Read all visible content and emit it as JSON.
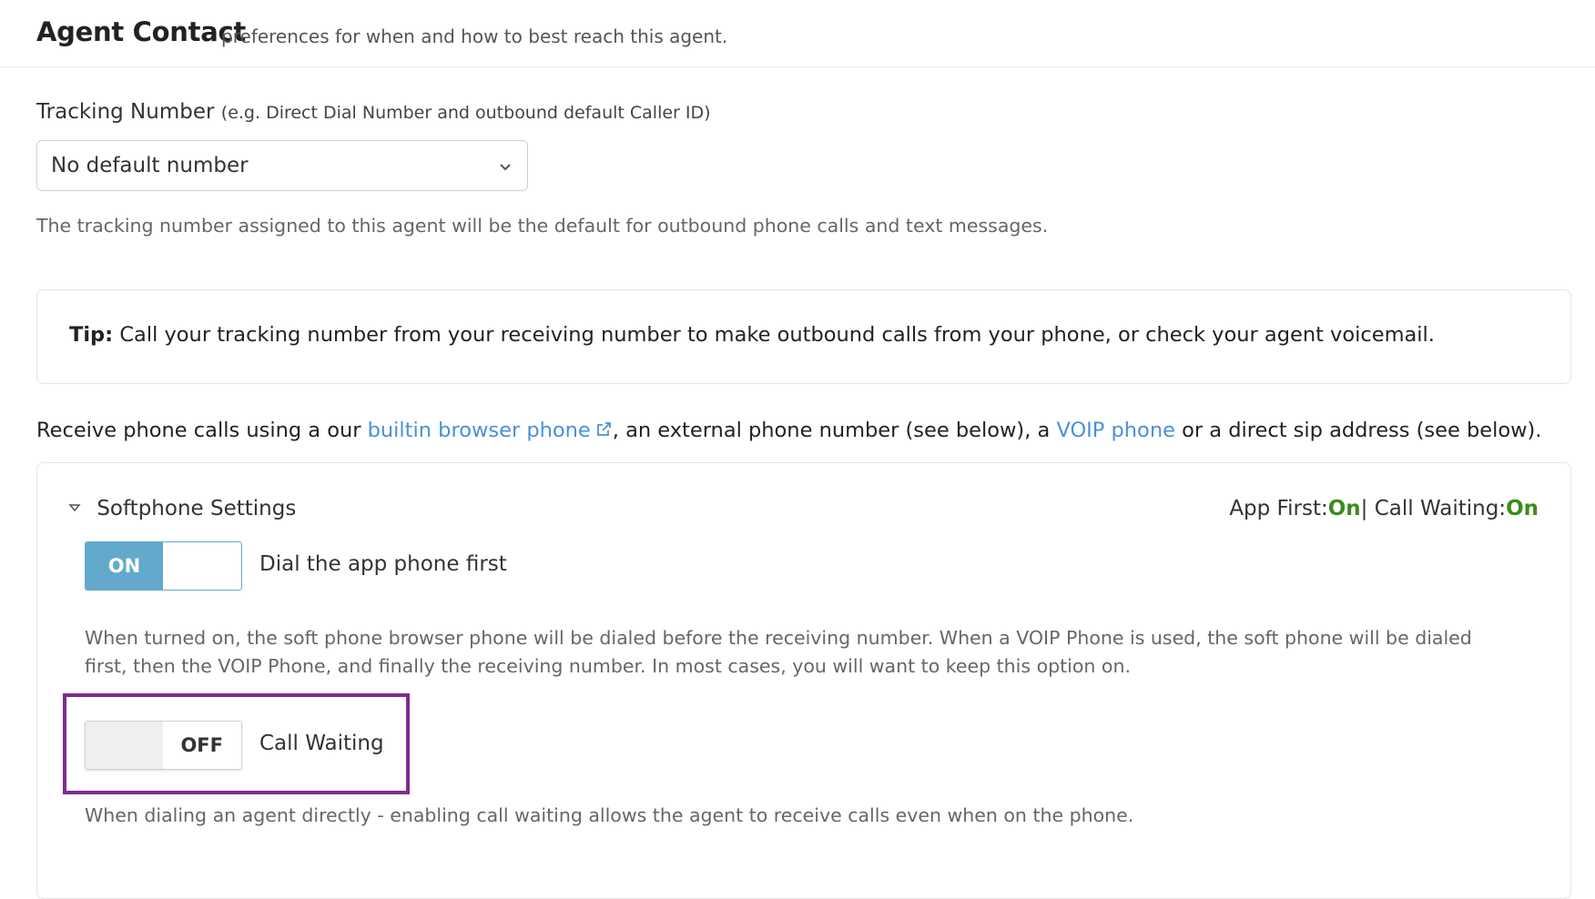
{
  "header": {
    "title": "Agent Contact",
    "subtitle": "preferences for when and how to best reach this agent."
  },
  "tracking": {
    "label": "Tracking Number",
    "label_hint": "(e.g. Direct Dial Number and outbound default Caller ID)",
    "selected_value": "No default number",
    "help_text": "The tracking number assigned to this agent will be the default for outbound phone calls and text messages."
  },
  "tip": {
    "prefix": "Tip:",
    "text": "Call your tracking number from your receiving number to make outbound calls from your phone, or check your agent voicemail."
  },
  "receive": {
    "text_1": "Receive phone calls using a our ",
    "link_1": "builtin browser phone",
    "text_2": ", an external phone number (see below), a ",
    "link_2": "VOIP phone",
    "text_3": " or a direct sip address (see below)."
  },
  "softphone": {
    "title": "Softphone Settings",
    "status_app_first_label": "App First:",
    "status_app_first_value": "On",
    "status_separator": "|",
    "status_call_waiting_label": "Call Waiting:",
    "status_call_waiting_value": "On",
    "dial_app_toggle_state": "ON",
    "dial_app_label": "Dial the app phone first",
    "dial_app_desc": "When turned on, the soft phone browser phone will be dialed before the receiving number. When a VOIP Phone is used, the soft phone will be dialed first, then the VOIP Phone, and finally the receiving number. In most cases, you will want to keep this option on.",
    "call_waiting_toggle_state": "OFF",
    "call_waiting_label": "Call Waiting",
    "call_waiting_desc": "When dialing an agent directly - enabling call waiting allows the agent to receive calls even when on the phone."
  },
  "colors": {
    "link": "#4a90d9",
    "toggle_on": "#62a9cc",
    "status_on": "#3e8a1c",
    "highlight": "#7e2b8d"
  }
}
